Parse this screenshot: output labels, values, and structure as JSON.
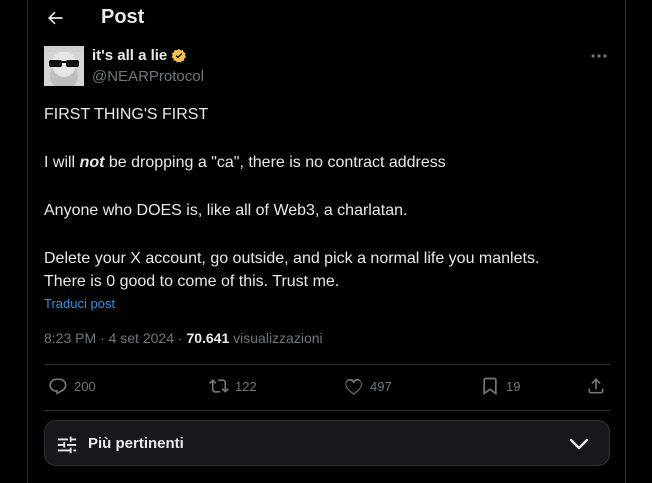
{
  "header": {
    "title": "Post"
  },
  "author": {
    "display_name": "it's all a lie",
    "handle": "@NEARProtocol"
  },
  "tweet": {
    "line1": "FIRST THING'S FIRST",
    "line2_pre": "I will ",
    "line2_emph": "not",
    "line2_post": " be dropping a \"ca\", there is no contract address",
    "line3": "Anyone who DOES is, like all of Web3, a charlatan.",
    "line4": "Delete your X account, go outside, and pick a normal life you manlets.",
    "line5": "There is 0 good to come of this. Trust me."
  },
  "translate_label": "Traduci post",
  "meta": {
    "time": "8:23 PM",
    "separator1": " · ",
    "date": "4 set 2024",
    "separator2": " · ",
    "views_count": "70.641",
    "views_label": " visualizzazioni"
  },
  "actions": {
    "replies": "200",
    "reposts": "122",
    "likes": "497",
    "bookmarks": "19"
  },
  "relevance": {
    "label": "Più pertinenti"
  },
  "colors": {
    "background": "#000000",
    "text": "#e7e9ea",
    "muted": "#71767b",
    "link": "#1d9bf0",
    "verified": "#f4c542",
    "border": "#2f3336"
  }
}
